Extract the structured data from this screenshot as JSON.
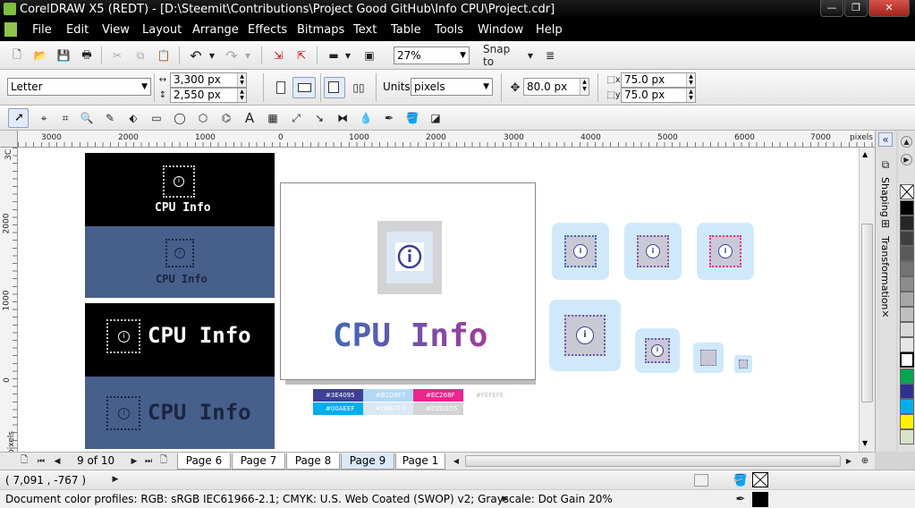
{
  "window": {
    "title": "CorelDRAW X5 (REDT) - [D:\\Steemit\\Contributions\\Project Good GitHub\\Info CPU\\Project.cdr]",
    "min": "—",
    "max": "❐",
    "close": "✕"
  },
  "menu": [
    "File",
    "Edit",
    "View",
    "Layout",
    "Arrange",
    "Effects",
    "Bitmaps",
    "Text",
    "Table",
    "Tools",
    "Window",
    "Help"
  ],
  "standard_toolbar": {
    "zoom": "27%",
    "snap_to": "Snap to"
  },
  "property_bar": {
    "paper": "Letter",
    "width": "3,300 px",
    "height": "2,550 px",
    "units_label": "Units:",
    "units": "pixels",
    "nudge": "80.0 px",
    "dup_x": "75.0 px",
    "dup_y": "75.0 px"
  },
  "ruler_h": {
    "labels": [
      "3000",
      "2000",
      "1000",
      "0",
      "1000",
      "2000",
      "3000",
      "4000",
      "5000",
      "6000",
      "7000"
    ],
    "unit": "pixels"
  },
  "ruler_v": {
    "labels": [
      "3C",
      "2000",
      "1000",
      "0"
    ],
    "unit": "pixels"
  },
  "artwork": {
    "logo_text": "CPU Info",
    "palette_swatches": [
      {
        "label": "#3E4095",
        "color": "#3E4095"
      },
      {
        "label": "#B1D8F7",
        "color": "#B1D8F7"
      },
      {
        "label": "#EC268F",
        "color": "#EC268F"
      },
      {
        "label": "#FEFEFE",
        "color": "#FEFEFE"
      },
      {
        "label": "#00AEEF",
        "color": "#00AEEF"
      },
      {
        "label": "#DBE7F3",
        "color": "#DBE7F3"
      },
      {
        "label": "#D2D3D5",
        "color": "#D2D3D5"
      }
    ]
  },
  "pages": {
    "counter": "9 of 10",
    "tabs": [
      "Page 6",
      "Page 7",
      "Page 8",
      "Page 9",
      "Page 1"
    ],
    "active": "Page 9"
  },
  "dockers": [
    "Shaping",
    "Transformation"
  ],
  "color_palette": [
    "#ffffff",
    "#000000",
    "#595959",
    "#7f7f7f",
    "#a6a6a6",
    "#cccccc",
    "#e6e6e6",
    "#00a650",
    "#2e3192",
    "#00aeef",
    "#fff200",
    "#ffffff"
  ],
  "status": {
    "coords": "( 7,091 , -767 )",
    "color_profiles": "Document color profiles: RGB: sRGB IEC61966-2.1; CMYK: U.S. Web Coated (SWOP) v2; Grayscale: Dot Gain 20%"
  },
  "colors": {
    "canvas_panel_dark": "#000000",
    "canvas_panel_blue": "#475f8b",
    "accent_purple": "#3e4095",
    "accent_pink": "#ec268f",
    "accent_cyan": "#00aeef"
  }
}
